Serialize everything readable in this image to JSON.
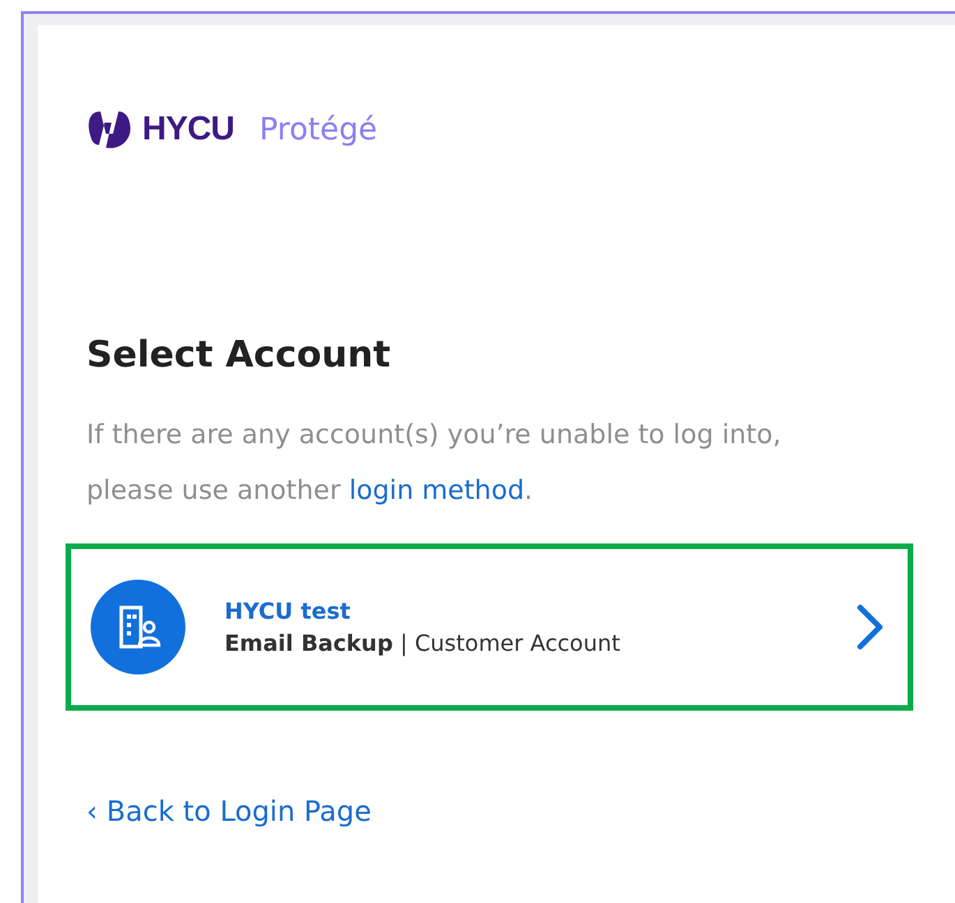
{
  "logo": {
    "brand": "HYCU",
    "product": "Protégé"
  },
  "heading": "Select Account",
  "intro": {
    "text": "If there are any account(s) you’re unable to log into, please use another",
    "link": "login method",
    "after": "."
  },
  "accounts": [
    {
      "name": "HYCU test",
      "type": "Email Backup",
      "separator": "|",
      "role": "Customer Account",
      "highlighted": true
    }
  ],
  "back_link": "‹ Back to Login Page"
}
